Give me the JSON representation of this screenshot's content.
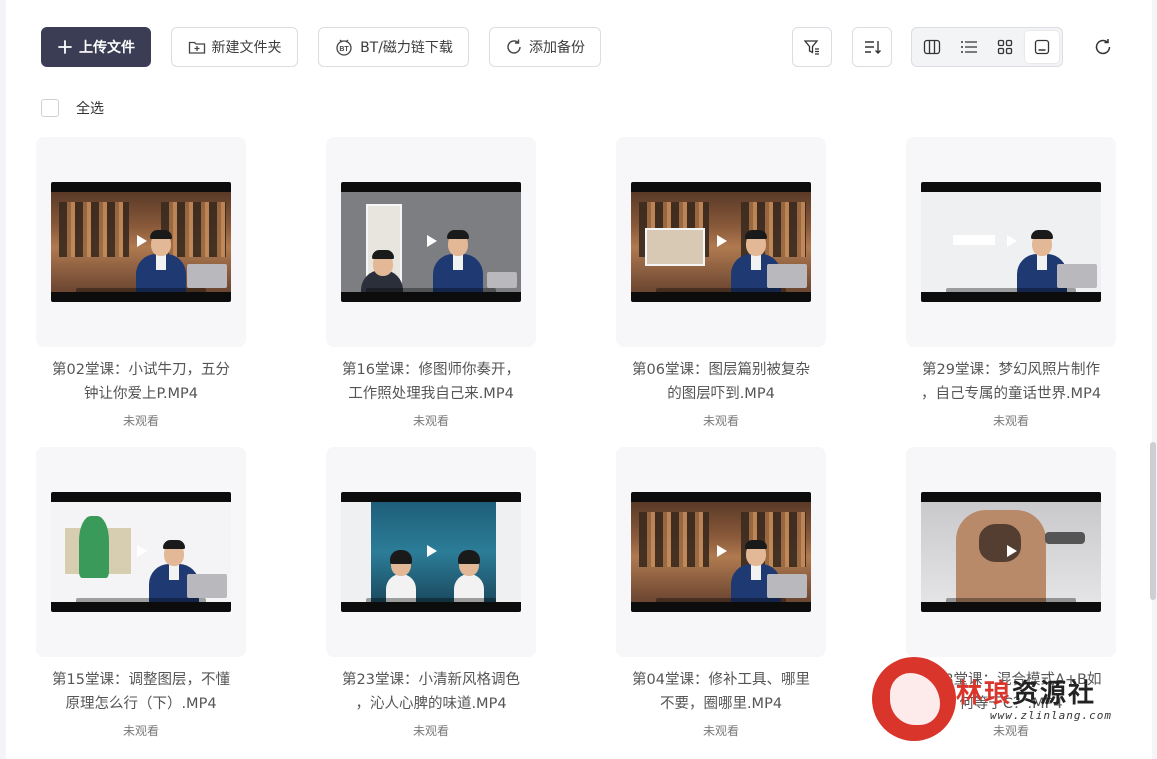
{
  "toolbar": {
    "upload_label": "上传文件",
    "new_folder_label": "新建文件夹",
    "bt_label": "BT/磁力链下载",
    "backup_label": "添加备份"
  },
  "select_all_label": "全选",
  "files": [
    {
      "title_line1": "第02堂课：小试牛刀，五分",
      "title_line2": "钟让你爱上P.MP4",
      "status": "未观看",
      "scene": "study"
    },
    {
      "title_line1": "第16堂课：修图师你奏开，",
      "title_line2": "工作照处理我自己来.MP4",
      "status": "未观看",
      "scene": "portrait"
    },
    {
      "title_line1": "第06堂课：图层篇别被复杂",
      "title_line2": "的图层吓到.MP4",
      "status": "未观看",
      "scene": "study"
    },
    {
      "title_line1": "第29堂课：梦幻风照片制作",
      "title_line2": "，自己专属的童话世界.MP4",
      "status": "未观看",
      "scene": "white"
    },
    {
      "title_line1": "第15堂课：调整图层，不懂",
      "title_line2": "原理怎么行（下）.MP4",
      "status": "未观看",
      "scene": "white-photo"
    },
    {
      "title_line1": "第23堂课：小清新风格调色",
      "title_line2": "，沁人心脾的味道.MP4",
      "status": "未观看",
      "scene": "ocean"
    },
    {
      "title_line1": "第04堂课：修补工具、哪里",
      "title_line2": "不要，圈哪里.MP4",
      "status": "未观看",
      "scene": "study"
    },
    {
      "title_line1": "第08堂课：混合模式A+B如",
      "title_line2": "何等于C？.MP4",
      "status": "未观看",
      "scene": "tattoo"
    }
  ],
  "watermark": {
    "text_red": "林琅",
    "text_black": "资源社",
    "url": "www.zlinlang.com"
  },
  "colors": {
    "primary": "#3b3d55",
    "card_bg": "#f7f7f9",
    "watermark_red": "#d9352b"
  }
}
